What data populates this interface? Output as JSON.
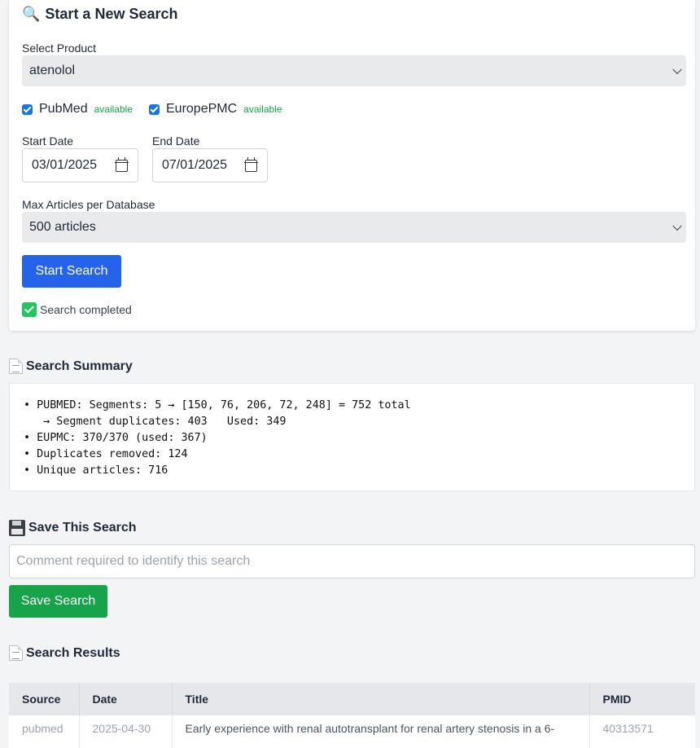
{
  "search_form": {
    "heading": "Start a New Search",
    "heading_icon": "magnifier-icon",
    "product_label": "Select Product",
    "product_value": "atenolol",
    "databases": [
      {
        "name": "PubMed",
        "status": "available",
        "checked": true
      },
      {
        "name": "EuropePMC",
        "status": "available",
        "checked": true
      }
    ],
    "start_date_label": "Start Date",
    "start_date_value": "03/01/2025",
    "end_date_label": "End Date",
    "end_date_value": "07/01/2025",
    "max_label": "Max Articles per Database",
    "max_value": "500 articles",
    "start_button": "Start Search",
    "status_text": "Search completed"
  },
  "summary": {
    "heading": "Search Summary",
    "lines": [
      "• PUBMED: Segments: 5 → [150, 76, 206, 72, 248] = 752 total",
      "   → Segment duplicates: 403   Used: 349",
      "• EUPMC: 370/370 (used: 367)",
      "• Duplicates removed: 124",
      "• Unique articles: 716"
    ]
  },
  "save": {
    "heading": "Save This Search",
    "comment_placeholder": "Comment required to identify this search",
    "comment_value": "",
    "button": "Save Search"
  },
  "results": {
    "heading": "Search Results",
    "columns": [
      "Source",
      "Date",
      "Title",
      "PMID"
    ],
    "rows": [
      {
        "source": "pubmed",
        "date": "2025-04-30",
        "title": "Early experience with renal autotransplant for renal artery stenosis in a 6-",
        "pmid": "40313571"
      }
    ]
  },
  "colors": {
    "primary": "#2563eb",
    "success": "#16a34a",
    "available": "#16a34a"
  }
}
